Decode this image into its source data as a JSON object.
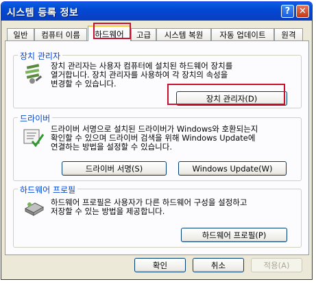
{
  "window": {
    "title": "시스템 등록 정보",
    "help_glyph": "?",
    "close_glyph": "✕"
  },
  "tabs": [
    {
      "label": "일반"
    },
    {
      "label": "컴퓨터 이름"
    },
    {
      "label": "하드웨어"
    },
    {
      "label": "고급"
    },
    {
      "label": "시스템 복원"
    },
    {
      "label": "자동 업데이트"
    },
    {
      "label": "원격"
    }
  ],
  "device_manager": {
    "title": "장치 관리자",
    "description": "장치 관리자는 사용자 컴퓨터에 설치된 하드웨어 장치를\n열거합니다. 장치 관리자를 사용하여 각 장치의 속성을\n변경할 수 있습니다.",
    "button_label": "장치 관리자(D)"
  },
  "driver": {
    "title": "드라이버",
    "description": "드라이버 서명으로 설치된 드라이버가 Windows와 호환되는지\n확인할 수 있으며 드라이버 검색을 위해 Windows Update에\n연결하는 방법을 설정할 수 있습니다.",
    "signing_label": "드라이버 서명(S)",
    "update_label": "Windows Update(W)"
  },
  "hardware_profile": {
    "title": "하드웨어 프로필",
    "description": "하드웨어 프로필은 사용자가 다른 하드웨어 구성을 설정하고\n저장할 수 있는 방법을 제공합니다.",
    "button_label": "하드웨어 프로필(P)"
  },
  "footer": {
    "ok_label": "확인",
    "cancel_label": "취소",
    "apply_label": "적용(A)"
  },
  "colors": {
    "highlight": "#c8102e",
    "group_title": "#0046d5"
  }
}
